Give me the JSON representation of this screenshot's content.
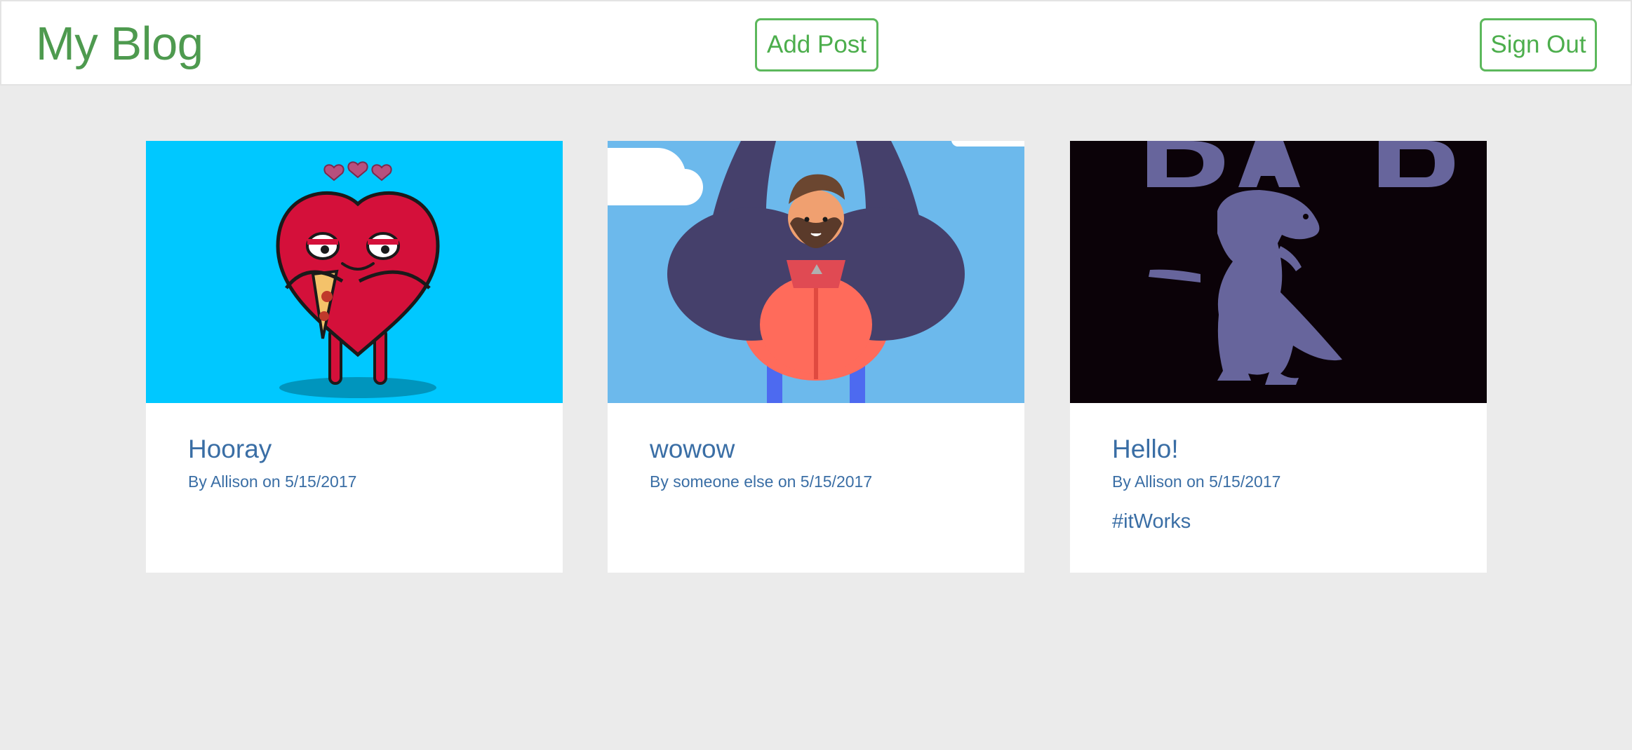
{
  "header": {
    "brand": "My Blog",
    "add_post_label": "Add Post",
    "sign_out_label": "Sign Out"
  },
  "colors": {
    "brand_green": "#4e9a4f",
    "button_border": "#5cb85c",
    "link_blue": "#3a6ea5",
    "page_background": "#ebebeb"
  },
  "posts": [
    {
      "title": "Hooray",
      "byline": "By Allison on 5/15/2017",
      "tags": "",
      "image_icon": "heart-eating-pizza-illustration"
    },
    {
      "title": "wowow",
      "byline": "By someone else on 5/15/2017",
      "tags": "",
      "image_icon": "bearded-man-flexing-illustration"
    },
    {
      "title": "Hello!",
      "byline": "By Allison on 5/15/2017",
      "tags": "#itWorks",
      "image_icon": "dancing-dinosaur-dab-illustration"
    }
  ]
}
